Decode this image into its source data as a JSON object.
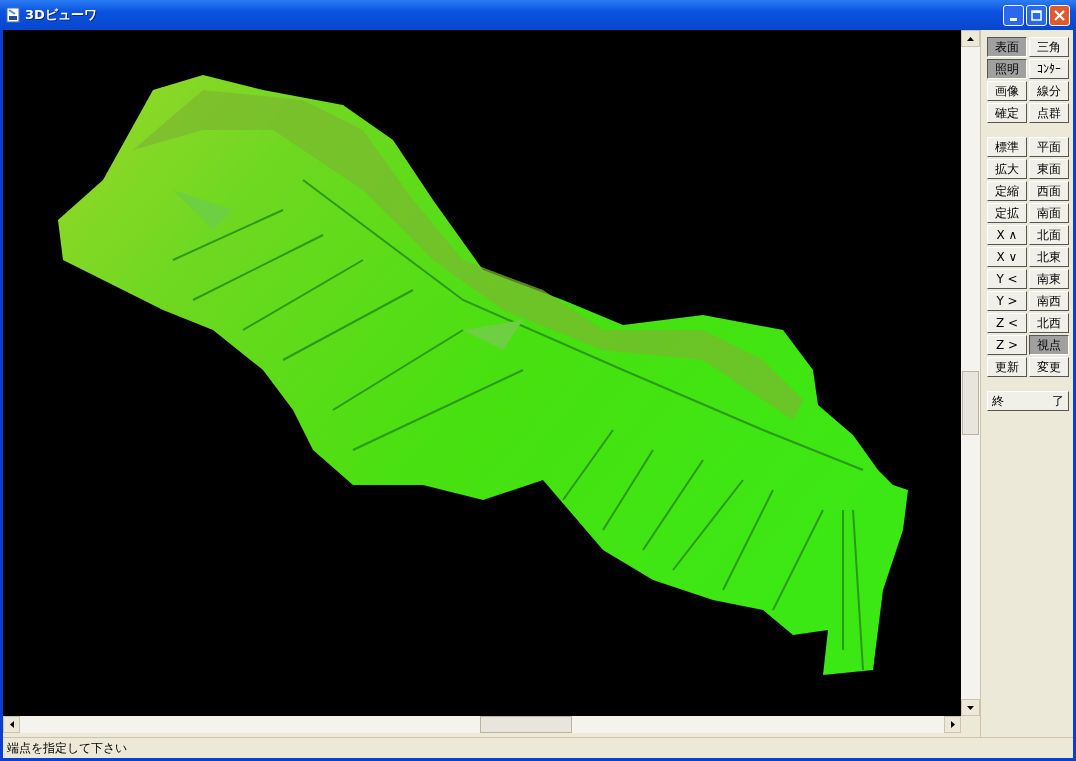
{
  "window": {
    "title": "3Dビューワ"
  },
  "panel": {
    "groups": [
      {
        "buttons": [
          {
            "label": "表面",
            "selected": true
          },
          {
            "label": "三角",
            "selected": false
          },
          {
            "label": "照明",
            "selected": true
          },
          {
            "label": "ｺﾝﾀｰ",
            "selected": false
          },
          {
            "label": "画像",
            "selected": false
          },
          {
            "label": "線分",
            "selected": false
          },
          {
            "label": "確定",
            "selected": false
          },
          {
            "label": "点群",
            "selected": false
          }
        ]
      },
      {
        "buttons": [
          {
            "label": "標準",
            "selected": false
          },
          {
            "label": "平面",
            "selected": false
          },
          {
            "label": "拡大",
            "selected": false
          },
          {
            "label": "東面",
            "selected": false
          },
          {
            "label": "定縮",
            "selected": false
          },
          {
            "label": "西面",
            "selected": false
          },
          {
            "label": "定拡",
            "selected": false
          },
          {
            "label": "南面",
            "selected": false
          },
          {
            "label": "X ∧",
            "selected": false
          },
          {
            "label": "北面",
            "selected": false
          },
          {
            "label": "X ∨",
            "selected": false
          },
          {
            "label": "北東",
            "selected": false
          },
          {
            "label": "Y <",
            "selected": false
          },
          {
            "label": "南東",
            "selected": false
          },
          {
            "label": "Y >",
            "selected": false
          },
          {
            "label": "南西",
            "selected": false
          },
          {
            "label": "Z <",
            "selected": false
          },
          {
            "label": "北西",
            "selected": false
          },
          {
            "label": "Z >",
            "selected": false
          },
          {
            "label": "視点",
            "selected": true
          },
          {
            "label": "更新",
            "selected": false
          },
          {
            "label": "変更",
            "selected": false
          }
        ]
      },
      {
        "wide": true,
        "buttons": [
          {
            "label": "終　　　　了",
            "selected": false
          }
        ]
      }
    ]
  },
  "status_bar": {
    "text": "端点を指定して下さい"
  }
}
